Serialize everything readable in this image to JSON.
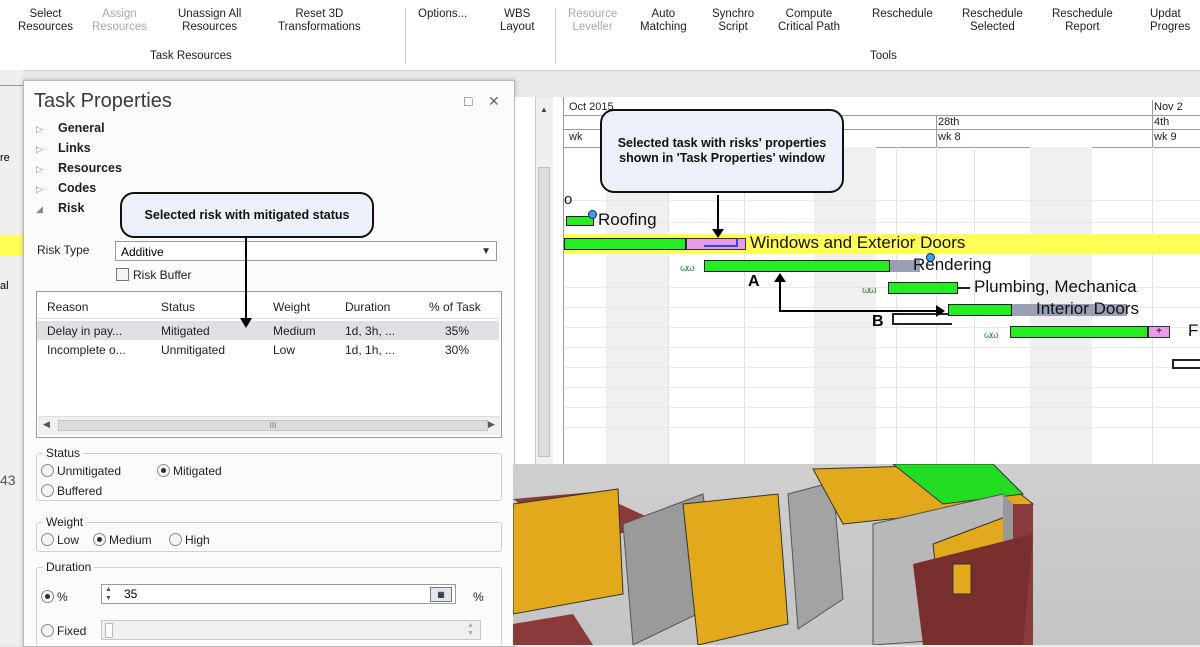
{
  "ribbon": {
    "buttons": [
      {
        "line1": "Select",
        "line2": "Resources",
        "disabled": false
      },
      {
        "line1": "Assign",
        "line2": "Resources",
        "disabled": true
      },
      {
        "line1": "Unassign All",
        "line2": "Resources",
        "disabled": false
      },
      {
        "line1": "Reset 3D",
        "line2": "Transformations",
        "disabled": false
      },
      {
        "line1": "Options...",
        "line2": "",
        "disabled": false
      },
      {
        "line1": "WBS",
        "line2": "Layout",
        "disabled": false
      },
      {
        "line1": "Resource",
        "line2": "Leveller",
        "disabled": true
      },
      {
        "line1": "Auto",
        "line2": "Matching",
        "disabled": false
      },
      {
        "line1": "Synchro",
        "line2": "Script",
        "disabled": false
      },
      {
        "line1": "Compute",
        "line2": "Critical Path",
        "disabled": false
      },
      {
        "line1": "Reschedule",
        "line2": "",
        "disabled": false
      },
      {
        "line1": "Reschedule",
        "line2": "Selected",
        "disabled": false
      },
      {
        "line1": "Reschedule",
        "line2": "Report",
        "disabled": false
      },
      {
        "line1": "Updat",
        "line2": "Progres",
        "disabled": false
      }
    ],
    "groups": {
      "task_resources": "Task Resources",
      "tools": "Tools"
    }
  },
  "background_app": {
    "left_texts": [
      "re",
      "al",
      "43"
    ]
  },
  "task_properties": {
    "title": "Task Properties",
    "restore_icon": "□",
    "close_icon": "✕",
    "sections": [
      "General",
      "Links",
      "Resources",
      "Codes",
      "Risk"
    ],
    "risk_type_label": "Risk Type",
    "risk_type_value": "Additive",
    "risk_buffer_label": "Risk Buffer",
    "columns": [
      "Reason",
      "Status",
      "Weight",
      "Duration",
      "% of Task"
    ],
    "rows": [
      {
        "reason": "Delay in pay...",
        "status": "Mitigated",
        "weight": "Medium",
        "duration": "1d, 3h, ...",
        "pct": "35%",
        "selected": true
      },
      {
        "reason": "Incomplete o...",
        "status": "Unmitigated",
        "weight": "Low",
        "duration": "1d, 1h, ...",
        "pct": "30%",
        "selected": false
      }
    ],
    "scroll_thumb_text": "III",
    "status_group": {
      "title": "Status",
      "options": [
        "Unmitigated",
        "Mitigated",
        "Buffered"
      ],
      "selected": "Mitigated"
    },
    "weight_group": {
      "title": "Weight",
      "options": [
        "Low",
        "Medium",
        "High"
      ],
      "selected": "Medium"
    },
    "duration_group": {
      "title": "Duration",
      "pct_label": "%",
      "pct_value": "35",
      "pct_unit": "%",
      "fixed_label": "Fixed",
      "selected": "%"
    }
  },
  "gantt": {
    "months": [
      "Oct 2015",
      "Nov 2"
    ],
    "days": [
      "28th",
      "4th"
    ],
    "weeks": [
      "wk",
      "wk 8",
      "wk 9"
    ],
    "tasks": [
      "o",
      "Roofing",
      "Windows and Exterior Doors",
      "Rendering",
      "Plumbing, Mechanica",
      "Interior Doors",
      "F"
    ],
    "wave_mark": "ωω",
    "plus_mark": "+"
  },
  "annotations": {
    "callout_task": "Selected task with risks' properties shown in 'Task Properties' window",
    "callout_risk": "Selected risk with mitigated status",
    "label_a": "A",
    "label_b": "B"
  },
  "colors": {
    "bar_green": "#22ee22",
    "highlight_yellow": "#ffff55",
    "risk_pink": "#e89ae8",
    "callout_bg": "#ecf0f8"
  }
}
